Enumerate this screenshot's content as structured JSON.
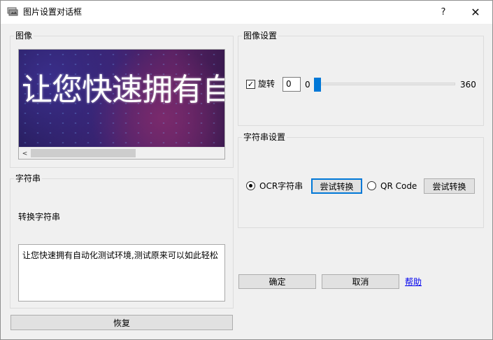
{
  "window": {
    "title": "图片设置对话框",
    "help_button": "?",
    "close_button": "✕"
  },
  "image_group": {
    "title": "图像",
    "image_text": "让您快速拥有自动化测试环境",
    "scroll_left": "<"
  },
  "string_group": {
    "title": "字符串",
    "convert_label": "转换字符串",
    "result_text": "让您快速拥有自动化测试环境,测试原来可以如此轻松"
  },
  "restore_button": "恢复",
  "image_settings": {
    "title": "图像设置",
    "rotate_checked": true,
    "rotate_check_mark": "✓",
    "rotate_label": "旋转",
    "rotate_value": "0",
    "slider_min": "0",
    "slider_max": "360"
  },
  "string_settings": {
    "title": "字符串设置",
    "ocr_label": "OCR字符串",
    "ocr_try_button": "尝试转换",
    "qr_label": "QR Code",
    "qr_try_button": "尝试转换"
  },
  "ok_button": "确定",
  "cancel_button": "取消",
  "help_link": "帮助"
}
